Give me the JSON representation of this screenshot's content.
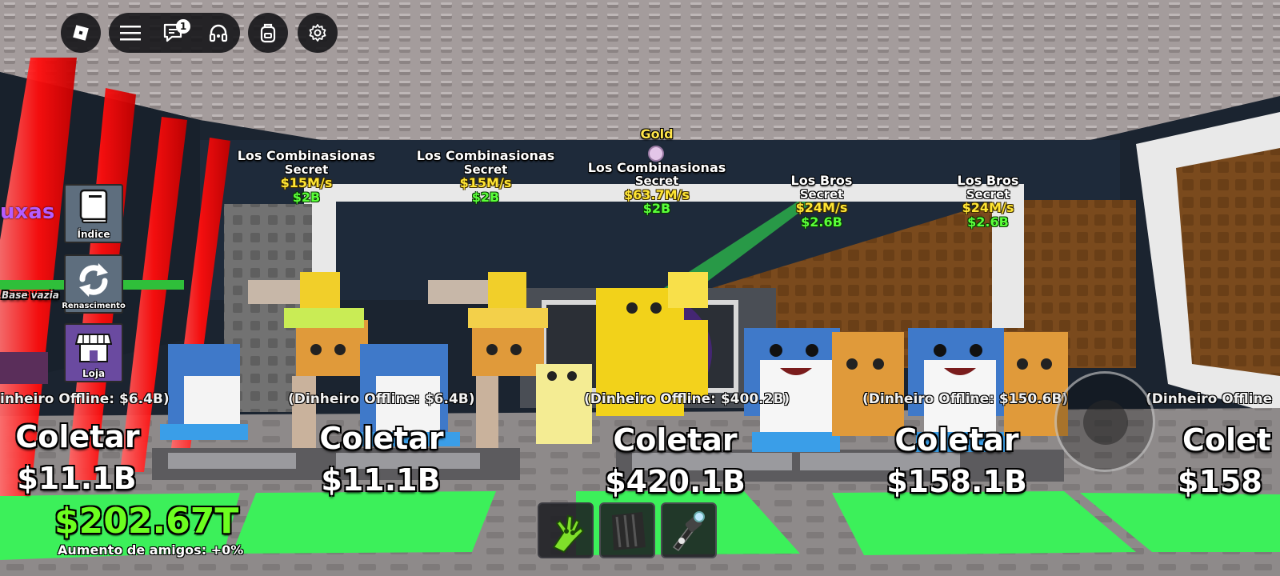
{
  "topbar": {
    "roblox_icon": "roblox-logo-icon",
    "menu_icon": "hamburger-menu-icon",
    "chat_icon": "chat-icon",
    "chat_badge": "1",
    "voice_icon": "headset-icon",
    "backpack_icon": "backpack-icon",
    "settings_icon": "gear-icon"
  },
  "sidebar": {
    "partial_text": "uxas",
    "items": [
      {
        "label": "Índice",
        "icon": "book-icon"
      },
      {
        "label": "Renascimento",
        "icon": "refresh-icon"
      },
      {
        "label": "Loja",
        "icon": "shop-icon"
      }
    ],
    "base_sign": "Base vazia"
  },
  "billboards": [
    {
      "name": "Los Combinasionas",
      "rarity": "Secret",
      "rate": "$15M/s",
      "price": "$2B"
    },
    {
      "name": "Los Combinasionas",
      "rarity": "Secret",
      "rate": "$15M/s",
      "price": "$2B"
    },
    {
      "mutation": "Gold",
      "name": "Los Combinasionas",
      "rarity": "Secret",
      "rate": "$63.7M/s",
      "price": "$2B"
    },
    {
      "name": "Los Bros",
      "rarity": "Secret",
      "rate": "$24M/s",
      "price": "$2.6B"
    },
    {
      "name": "Los Bros",
      "rarity": "Secret",
      "rate": "$24M/s",
      "price": "$2.6B"
    }
  ],
  "collect_pads": [
    {
      "offline": "inheiro Offline: $6.4B)",
      "label": "Coletar",
      "amount": "$11.1B"
    },
    {
      "offline": "(Dinheiro Offline: $6.4B)",
      "label": "Coletar",
      "amount": "$11.1B"
    },
    {
      "offline": "(Dinheiro Offline: $400.2B)",
      "label": "Coletar",
      "amount": "$420.1B"
    },
    {
      "offline": "(Dinheiro Offline: $150.6B)",
      "label": "Coletar",
      "amount": "$158.1B"
    },
    {
      "offline": "(Dinheiro Offline",
      "label": "Colet",
      "amount": "$158"
    }
  ],
  "hud": {
    "money": "$202.67T",
    "friend_boost": "Aumento de amigos: +0%"
  },
  "hotbar": [
    {
      "icon": "green-slap-glove-icon"
    },
    {
      "icon": "dark-cloak-icon"
    },
    {
      "icon": "grapple-gun-icon"
    }
  ],
  "joystick": {
    "icon": "jump-button-icon"
  },
  "colors": {
    "money_green": "#6cff1f",
    "rate_yellow": "#ffe533",
    "price_green": "#5aff3a",
    "laser_red": "#ff1a1a",
    "pad_green": "#3cf05a"
  }
}
